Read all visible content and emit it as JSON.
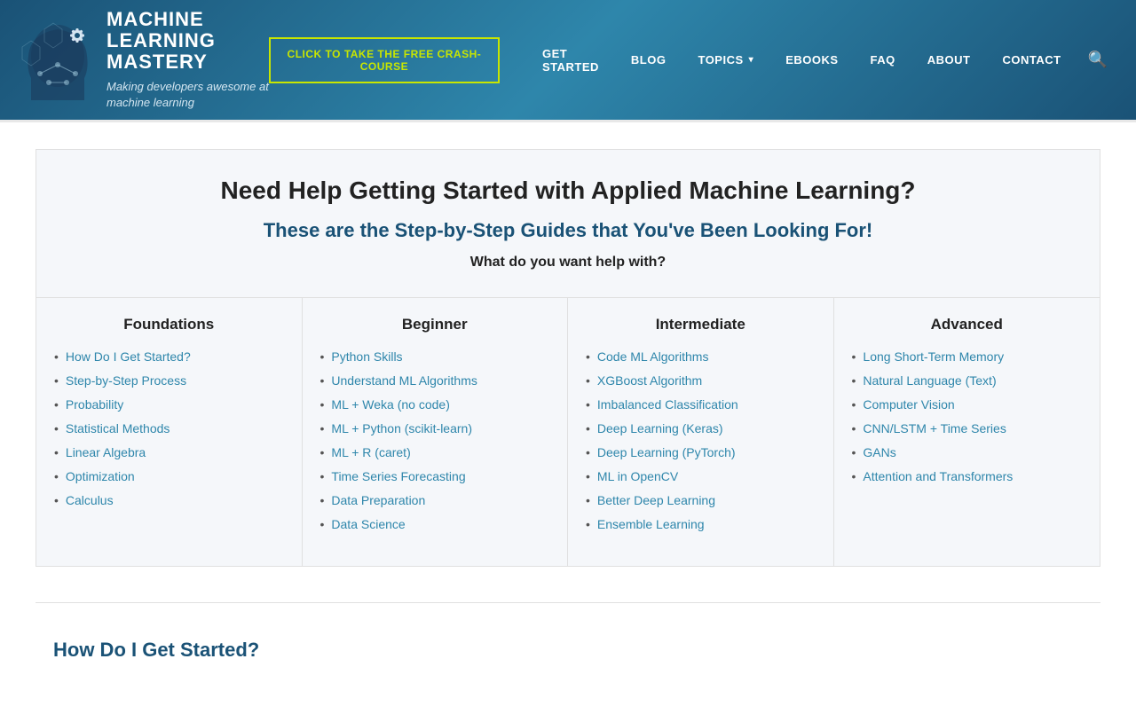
{
  "header": {
    "logo_title": "MACHINE\nLEARNING\nMASTERY",
    "logo_subtitle": "Making developers awesome at\nmachine learning",
    "crash_course_btn": "CLICK TO TAKE THE FREE CRASH-COURSE",
    "nav": [
      {
        "label": "GET STARTED",
        "has_arrow": false
      },
      {
        "label": "BLOG",
        "has_arrow": false
      },
      {
        "label": "TOPICS",
        "has_arrow": true
      },
      {
        "label": "EBOOKS",
        "has_arrow": false
      },
      {
        "label": "FAQ",
        "has_arrow": false
      },
      {
        "label": "ABOUT",
        "has_arrow": false
      },
      {
        "label": "CONTACT",
        "has_arrow": false
      }
    ]
  },
  "hero": {
    "title": "Need Help Getting Started with Applied Machine Learning?",
    "subtitle": "These are the Step-by-Step Guides that You've Been Looking For!",
    "question": "What do you want help with?"
  },
  "columns": [
    {
      "header": "Foundations",
      "items": [
        "How Do I Get Started?",
        "Step-by-Step Process",
        "Probability",
        "Statistical Methods",
        "Linear Algebra",
        "Optimization",
        "Calculus"
      ]
    },
    {
      "header": "Beginner",
      "items": [
        "Python Skills",
        "Understand ML Algorithms",
        "ML + Weka (no code)",
        "ML + Python (scikit-learn)",
        "ML + R (caret)",
        "Time Series Forecasting",
        "Data Preparation",
        "Data Science"
      ]
    },
    {
      "header": "Intermediate",
      "items": [
        "Code ML Algorithms",
        "XGBoost Algorithm",
        "Imbalanced Classification",
        "Deep Learning (Keras)",
        "Deep Learning (PyTorch)",
        "ML in OpenCV",
        "Better Deep Learning",
        "Ensemble Learning"
      ]
    },
    {
      "header": "Advanced",
      "items": [
        "Long Short-Term Memory",
        "Natural Language (Text)",
        "Computer Vision",
        "CNN/LSTM + Time Series",
        "GANs",
        "Attention and Transformers"
      ]
    }
  ],
  "bottom_teaser": {
    "title": "How Do I Get Started?"
  },
  "colors": {
    "header_bg_start": "#1a5276",
    "header_bg_end": "#2e86ab",
    "link_color": "#2e86ab",
    "accent_yellow": "#c8e600",
    "hero_bg": "#f5f7fa"
  }
}
